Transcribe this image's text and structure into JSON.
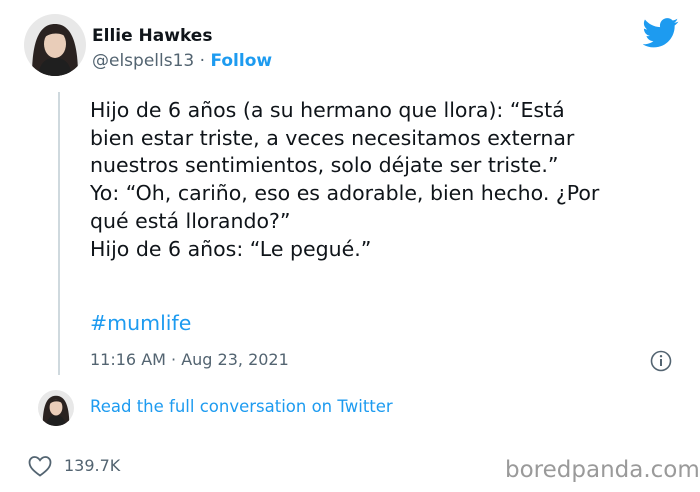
{
  "author": {
    "name": "Ellie Hawkes",
    "handle": "@elspells13",
    "separator": "·",
    "follow_label": "Follow"
  },
  "tweet": {
    "lines": [
      "Hijo de 6 años (a su hermano que llora): “Está",
      "bien estar triste, a veces necesitamos externar",
      "nuestros sentimientos, solo déjate ser triste.”",
      "Yo: “Oh, cariño, eso es adorable, bien hecho. ¿Por",
      "qué está llorando?”",
      "Hijo de 6 años: “Le pegué.”"
    ],
    "hashtag": "#mumlife",
    "timestamp": "11:16 AM · Aug 23, 2021"
  },
  "thread": {
    "read_more_label": "Read the full conversation on Twitter"
  },
  "engagement": {
    "likes": "139.7K"
  },
  "watermark": "boredpanda.com",
  "icons": {
    "brand": "twitter-bird-icon",
    "info": "info-icon",
    "like": "heart-icon"
  },
  "colors": {
    "accent": "#1d9bf0",
    "secondary_text": "#536471",
    "primary_text": "#0f1419"
  }
}
